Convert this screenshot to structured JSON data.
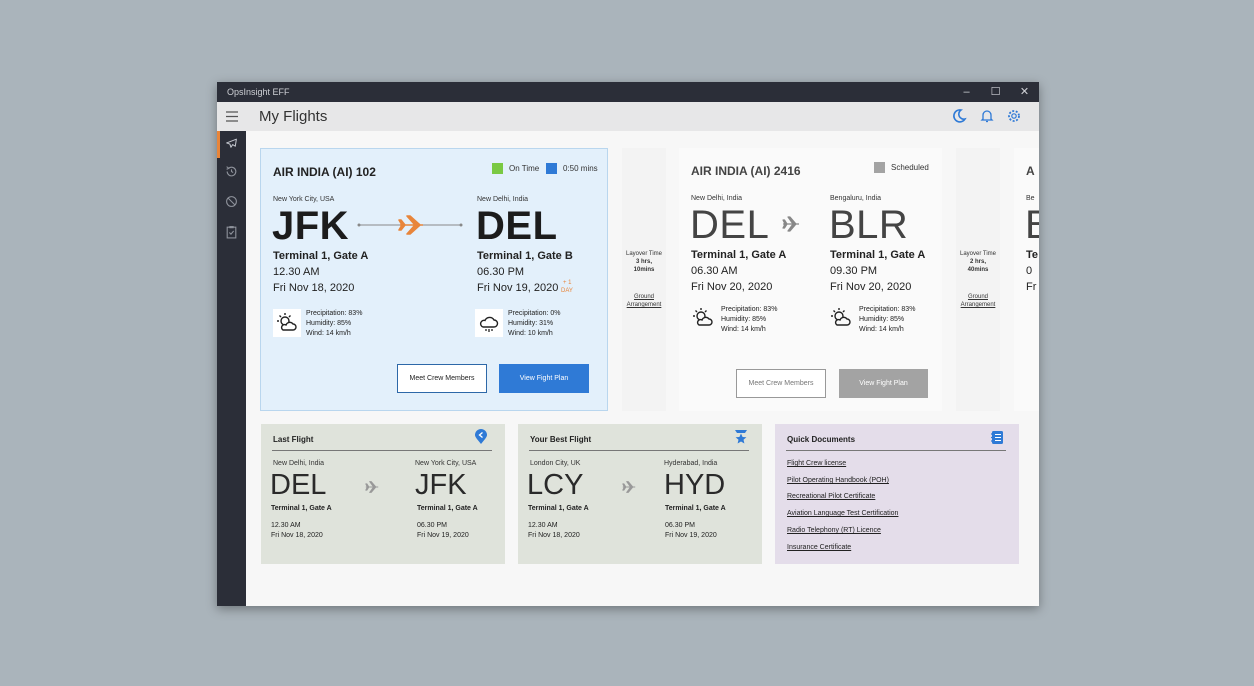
{
  "window": {
    "title": "OpsInsight EFF",
    "controls": [
      "–",
      "☐",
      "✕"
    ]
  },
  "header": {
    "title": "My Flights"
  },
  "sidebar": {
    "items": [
      "flights-icon",
      "history-icon",
      "blocked-icon",
      "checklist-icon"
    ]
  },
  "flights": [
    {
      "title": "AIR INDIA (AI) 102",
      "status": {
        "label": "On Time",
        "color": "#7ac943"
      },
      "delay": {
        "label": "0:50 mins",
        "color": "#2f7ad6"
      },
      "from": {
        "city": "New York City, USA",
        "code": "JFK",
        "terminal": "Terminal 1, Gate A",
        "time": "12.30 AM",
        "date": "Fri Nov 18, 2020",
        "weather": [
          "Precipitation: 83%",
          "Humidity: 85%",
          "Wind: 14 km/h"
        ]
      },
      "to": {
        "city": "New Delhi, India",
        "code": "DEL",
        "terminal": "Terminal 1, Gate B",
        "time": "06.30 PM",
        "date": "Fri Nov 19, 2020",
        "plus_day": "+ 1",
        "plus_day_unit": "DAY",
        "weather": [
          "Precipitation: 0%",
          "Humidity: 31%",
          "Wind: 10 km/h"
        ]
      },
      "buttons": {
        "crew": "Meet Crew Members",
        "plan": "View Fight Plan"
      }
    },
    {
      "title": "AIR INDIA (AI) 2416",
      "status": {
        "label": "Scheduled",
        "color": "#a3a3a3"
      },
      "from": {
        "city": "New Delhi, India",
        "code": "DEL",
        "terminal": "Terminal 1, Gate A",
        "time": "06.30 AM",
        "date": "Fri Nov 20, 2020",
        "weather": [
          "Precipitation: 83%",
          "Humidity: 85%",
          "Wind: 14 km/h"
        ]
      },
      "to": {
        "city": "Bengaluru, India",
        "code": "BLR",
        "terminal": "Terminal 1, Gate A",
        "time": "09.30 PM",
        "date": "Fri Nov 20, 2020",
        "weather": [
          "Precipitation: 83%",
          "Humidity: 85%",
          "Wind: 14 km/h"
        ]
      },
      "buttons": {
        "crew": "Meet Crew Members",
        "plan": "View Fight Plan"
      }
    }
  ],
  "layovers": [
    {
      "label": "Layover Time",
      "duration_1": "3 hrs,",
      "duration_2": "10mins",
      "link": "Ground Arrangement"
    },
    {
      "label": "Layover Time",
      "duration_1": "2 hrs,",
      "duration_2": "40mins",
      "link": "Ground Arrangement"
    }
  ],
  "partial_card": {
    "title": "A",
    "city": "Be",
    "code": "B",
    "terminal": "Te",
    "time": "0",
    "date": "Fr"
  },
  "last_flight": {
    "heading": "Last Flight",
    "from": {
      "city": "New Delhi, India",
      "code": "DEL",
      "terminal": "Terminal 1, Gate A",
      "time": "12.30 AM",
      "date": "Fri Nov 18, 2020"
    },
    "to": {
      "city": "New York City, USA",
      "code": "JFK",
      "terminal": "Terminal 1, Gate A",
      "time": "06.30 PM",
      "date": "Fri Nov 19, 2020"
    }
  },
  "best_flight": {
    "heading": "Your Best Flight",
    "from": {
      "city": "London City, UK",
      "code": "LCY",
      "terminal": "Terminal 1, Gate A",
      "time": "12.30 AM",
      "date": "Fri Nov 18, 2020"
    },
    "to": {
      "city": "Hyderabad, India",
      "code": "HYD",
      "terminal": "Terminal 1, Gate A",
      "time": "06.30 PM",
      "date": "Fri Nov 19, 2020"
    }
  },
  "quick_docs": {
    "heading": "Quick Documents",
    "links": [
      "Flight Crew license ",
      "Pilot Operating Handbook (POH)",
      "Recreational Pilot Certificate",
      "Aviation Language Test Certification",
      "Radio Telephony (RT) Licence",
      "Insurance Certificate"
    ]
  },
  "colors": {
    "accent": "#e8853a",
    "primary": "#2f7ad6",
    "sidebar": "#2b2e38"
  }
}
